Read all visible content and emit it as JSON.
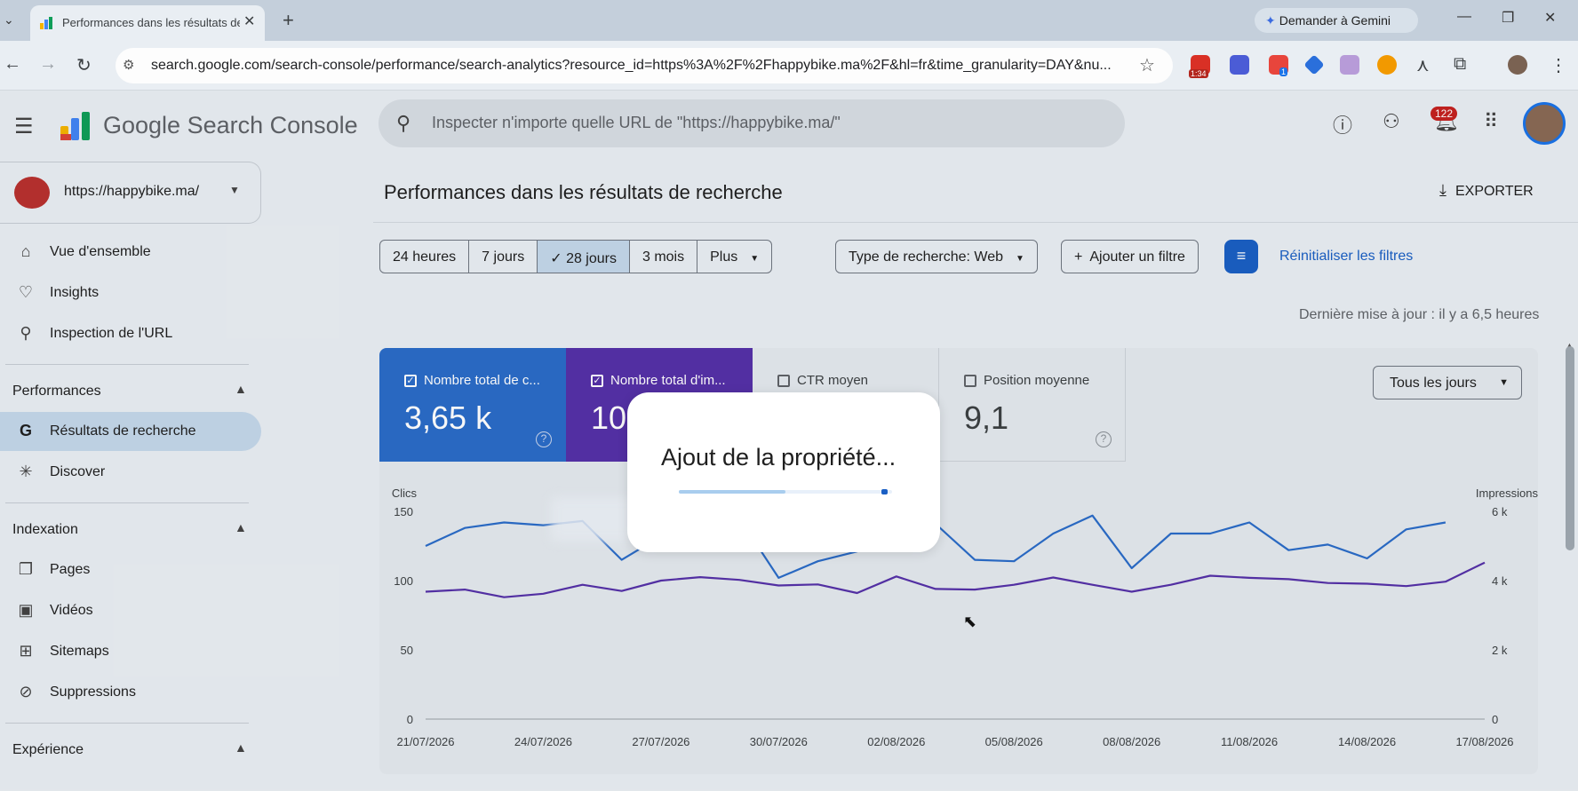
{
  "browser": {
    "tab_title": "Performances dans les résultats de recherche",
    "gemini_label": "Demander à Gemini",
    "url": "search.google.com/search-console/performance/search-analytics?resource_id=https%3A%2F%2Fhappybike.ma%2F&hl=fr&time_granularity=DAY&nu...",
    "ext_badge_time": "1:34",
    "ext_badge_count": "1"
  },
  "header": {
    "product_name": "Google Search Console",
    "search_placeholder": "Inspecter n'importe quelle URL de \"https://happybike.ma/\"",
    "notification_count": "122"
  },
  "sidebar": {
    "property_url": "https://happybike.ma/",
    "top_items": [
      {
        "label": "Vue d'ensemble",
        "icon": "home-icon"
      },
      {
        "label": "Insights",
        "icon": "lightbulb-icon"
      },
      {
        "label": "Inspection de l'URL",
        "icon": "search-icon"
      }
    ],
    "sections": [
      {
        "title": "Performances",
        "items": [
          {
            "label": "Résultats de recherche",
            "icon": "google-g-icon",
            "active": true
          },
          {
            "label": "Discover",
            "icon": "asterisk-icon"
          }
        ]
      },
      {
        "title": "Indexation",
        "items": [
          {
            "label": "Pages",
            "icon": "pages-icon"
          },
          {
            "label": "Vidéos",
            "icon": "video-icon"
          },
          {
            "label": "Sitemaps",
            "icon": "sitemap-icon"
          },
          {
            "label": "Suppressions",
            "icon": "eye-off-icon"
          }
        ]
      },
      {
        "title": "Expérience",
        "items": []
      }
    ]
  },
  "main": {
    "page_title": "Performances dans les résultats de recherche",
    "export_label": "EXPORTER",
    "date_ranges": [
      "24 heures",
      "7 jours",
      "28 jours",
      "3 mois",
      "Plus"
    ],
    "selected_range": "28 jours",
    "search_type_chip": "Type de recherche: Web",
    "add_filter_label": "Ajouter un filtre",
    "reset_filters_label": "Réinitialiser les filtres",
    "last_updated": "Dernière mise à jour : il y a 6,5 heures",
    "metrics": [
      {
        "label": "Nombre total de c...",
        "value": "3,65 k",
        "checked": true,
        "color": "#2b6cc8"
      },
      {
        "label": "Nombre total d'im...",
        "value": "10",
        "checked": true,
        "color": "#5531a8"
      },
      {
        "label": "CTR moyen",
        "value": "",
        "checked": false
      },
      {
        "label": "Position moyenne",
        "value": "9,1",
        "checked": false
      }
    ],
    "granularity_select": "Tous les jours"
  },
  "dialog": {
    "message": "Ajout de la propriété...",
    "progress": 0.5
  },
  "chart_data": {
    "type": "line",
    "x": [
      "21/07/2026",
      "22/07/2026",
      "23/07/2026",
      "24/07/2026",
      "25/07/2026",
      "26/07/2026",
      "27/07/2026",
      "28/07/2026",
      "29/07/2026",
      "30/07/2026",
      "31/07/2026",
      "01/08/2026",
      "02/08/2026",
      "03/08/2026",
      "04/08/2026",
      "05/08/2026",
      "06/08/2026",
      "07/08/2026",
      "08/08/2026",
      "09/08/2026",
      "10/08/2026",
      "11/08/2026",
      "12/08/2026",
      "13/08/2026",
      "14/08/2026",
      "15/08/2026",
      "16/08/2026",
      "17/08/2026"
    ],
    "x_tick_labels": [
      "21/07/2026",
      "24/07/2026",
      "27/07/2026",
      "30/07/2026",
      "02/08/2026",
      "05/08/2026",
      "08/08/2026",
      "11/08/2026",
      "14/08/2026",
      "17/08/2026"
    ],
    "series": [
      {
        "name": "Clics",
        "axis": "left",
        "color": "#2b6cc8",
        "values": [
          125,
          138,
          142,
          140,
          143,
          115,
          132,
          140,
          145,
          102,
          114,
          121,
          141,
          141,
          115,
          114,
          134,
          147,
          109,
          134,
          134,
          142,
          122,
          126,
          116,
          137,
          142,
          null
        ]
      },
      {
        "name": "Impressions",
        "axis": "right",
        "color": "#5531a8",
        "values": [
          3680,
          3740,
          3520,
          3620,
          3880,
          3700,
          4000,
          4100,
          4020,
          3860,
          3890,
          3640,
          4120,
          3760,
          3740,
          3880,
          4090,
          3880,
          3680,
          3880,
          4140,
          4080,
          4040,
          3930,
          3910,
          3840,
          3970,
          4520
        ]
      }
    ],
    "ylabel": "Clics",
    "y2label": "Impressions",
    "ylim": [
      0,
      150
    ],
    "y2lim": [
      0,
      6000
    ],
    "y_ticks": [
      "0",
      "50",
      "100",
      "150"
    ],
    "y2_ticks": [
      "0",
      "2 k",
      "4 k",
      "6 k"
    ],
    "grid": false
  }
}
